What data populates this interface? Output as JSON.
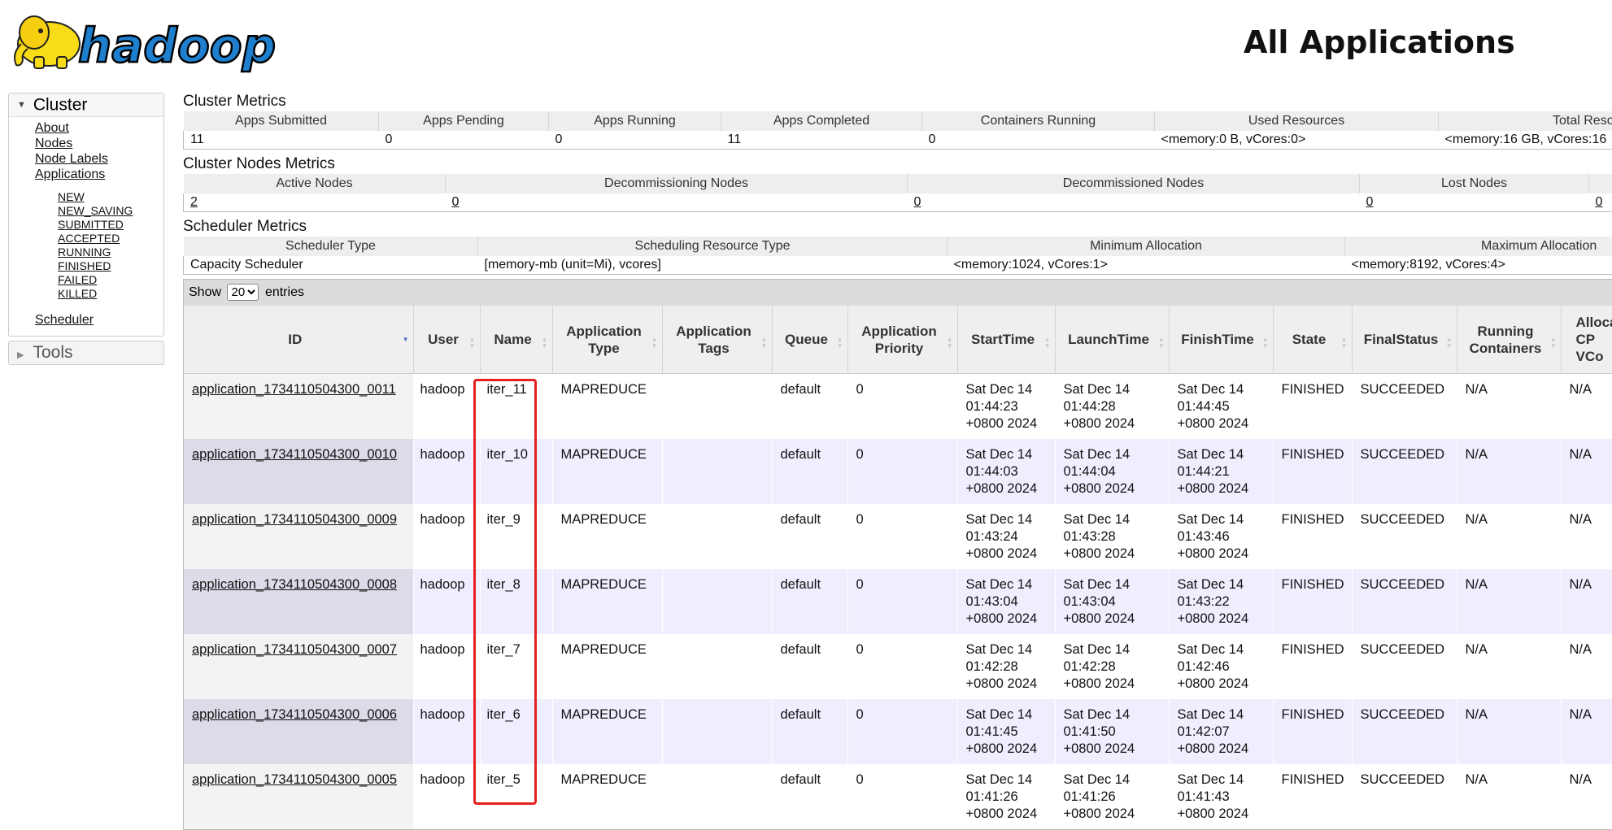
{
  "header": {
    "logo_text": "hadoop",
    "title": "All Applications"
  },
  "sidebar": {
    "cluster_label": "Cluster",
    "items": [
      "About",
      "Nodes",
      "Node Labels",
      "Applications"
    ],
    "app_states": [
      "NEW",
      "NEW_SAVING",
      "SUBMITTED",
      "ACCEPTED",
      "RUNNING",
      "FINISHED",
      "FAILED",
      "KILLED"
    ],
    "scheduler": "Scheduler",
    "tools_label": "Tools"
  },
  "cluster_metrics": {
    "title": "Cluster Metrics",
    "headers": [
      "Apps Submitted",
      "Apps Pending",
      "Apps Running",
      "Apps Completed",
      "Containers Running",
      "Used Resources",
      "Total Reso"
    ],
    "values": [
      "11",
      "0",
      "0",
      "11",
      "0",
      "<memory:0 B, vCores:0>",
      "<memory:16 GB, vCores:16"
    ]
  },
  "nodes_metrics": {
    "title": "Cluster Nodes Metrics",
    "headers": [
      "Active Nodes",
      "Decommissioning Nodes",
      "Decommissioned Nodes",
      "Lost Nodes",
      ""
    ],
    "values": [
      "2",
      "0",
      "0",
      "0",
      "0"
    ]
  },
  "scheduler_metrics": {
    "title": "Scheduler Metrics",
    "headers": [
      "Scheduler Type",
      "Scheduling Resource Type",
      "Minimum Allocation",
      "Maximum Allocation"
    ],
    "values": [
      "Capacity Scheduler",
      "[memory-mb (unit=Mi), vcores]",
      "<memory:1024, vCores:1>",
      "<memory:8192, vCores:4>"
    ]
  },
  "apps_table": {
    "show_label": "Show",
    "page_size": "20",
    "entries_label": "entries",
    "columns": [
      [
        "ID"
      ],
      [
        "User"
      ],
      [
        "Name"
      ],
      [
        "Application",
        "Type"
      ],
      [
        "Application",
        "Tags"
      ],
      [
        "Queue"
      ],
      [
        "Application",
        "Priority"
      ],
      [
        "StartTime"
      ],
      [
        "LaunchTime"
      ],
      [
        "FinishTime"
      ],
      [
        "State"
      ],
      [
        "FinalStatus"
      ],
      [
        "Running",
        "Containers"
      ],
      [
        "Alloca",
        "CP",
        "VCo"
      ]
    ],
    "rows": [
      {
        "id": "application_1734110504300_0011",
        "user": "hadoop",
        "name": "iter_11",
        "type": "MAPREDUCE",
        "tags": "",
        "queue": "default",
        "priority": "0",
        "start": [
          "Sat Dec 14",
          "01:44:23",
          "+0800 2024"
        ],
        "launch": [
          "Sat Dec 14",
          "01:44:28",
          "+0800 2024"
        ],
        "finish": [
          "Sat Dec 14",
          "01:44:45",
          "+0800 2024"
        ],
        "state": "FINISHED",
        "final": "SUCCEEDED",
        "running": "N/A",
        "alloc": "N/A"
      },
      {
        "id": "application_1734110504300_0010",
        "user": "hadoop",
        "name": "iter_10",
        "type": "MAPREDUCE",
        "tags": "",
        "queue": "default",
        "priority": "0",
        "start": [
          "Sat Dec 14",
          "01:44:03",
          "+0800 2024"
        ],
        "launch": [
          "Sat Dec 14",
          "01:44:04",
          "+0800 2024"
        ],
        "finish": [
          "Sat Dec 14",
          "01:44:21",
          "+0800 2024"
        ],
        "state": "FINISHED",
        "final": "SUCCEEDED",
        "running": "N/A",
        "alloc": "N/A"
      },
      {
        "id": "application_1734110504300_0009",
        "user": "hadoop",
        "name": "iter_9",
        "type": "MAPREDUCE",
        "tags": "",
        "queue": "default",
        "priority": "0",
        "start": [
          "Sat Dec 14",
          "01:43:24",
          "+0800 2024"
        ],
        "launch": [
          "Sat Dec 14",
          "01:43:28",
          "+0800 2024"
        ],
        "finish": [
          "Sat Dec 14",
          "01:43:46",
          "+0800 2024"
        ],
        "state": "FINISHED",
        "final": "SUCCEEDED",
        "running": "N/A",
        "alloc": "N/A"
      },
      {
        "id": "application_1734110504300_0008",
        "user": "hadoop",
        "name": "iter_8",
        "type": "MAPREDUCE",
        "tags": "",
        "queue": "default",
        "priority": "0",
        "start": [
          "Sat Dec 14",
          "01:43:04",
          "+0800 2024"
        ],
        "launch": [
          "Sat Dec 14",
          "01:43:04",
          "+0800 2024"
        ],
        "finish": [
          "Sat Dec 14",
          "01:43:22",
          "+0800 2024"
        ],
        "state": "FINISHED",
        "final": "SUCCEEDED",
        "running": "N/A",
        "alloc": "N/A"
      },
      {
        "id": "application_1734110504300_0007",
        "user": "hadoop",
        "name": "iter_7",
        "type": "MAPREDUCE",
        "tags": "",
        "queue": "default",
        "priority": "0",
        "start": [
          "Sat Dec 14",
          "01:42:28",
          "+0800 2024"
        ],
        "launch": [
          "Sat Dec 14",
          "01:42:28",
          "+0800 2024"
        ],
        "finish": [
          "Sat Dec 14",
          "01:42:46",
          "+0800 2024"
        ],
        "state": "FINISHED",
        "final": "SUCCEEDED",
        "running": "N/A",
        "alloc": "N/A"
      },
      {
        "id": "application_1734110504300_0006",
        "user": "hadoop",
        "name": "iter_6",
        "type": "MAPREDUCE",
        "tags": "",
        "queue": "default",
        "priority": "0",
        "start": [
          "Sat Dec 14",
          "01:41:45",
          "+0800 2024"
        ],
        "launch": [
          "Sat Dec 14",
          "01:41:50",
          "+0800 2024"
        ],
        "finish": [
          "Sat Dec 14",
          "01:42:07",
          "+0800 2024"
        ],
        "state": "FINISHED",
        "final": "SUCCEEDED",
        "running": "N/A",
        "alloc": "N/A"
      },
      {
        "id": "application_1734110504300_0005",
        "user": "hadoop",
        "name": "iter_5",
        "type": "MAPREDUCE",
        "tags": "",
        "queue": "default",
        "priority": "0",
        "start": [
          "Sat Dec 14",
          "01:41:26",
          "+0800 2024"
        ],
        "launch": [
          "Sat Dec 14",
          "01:41:26",
          "+0800 2024"
        ],
        "finish": [
          "Sat Dec 14",
          "01:41:43",
          "+0800 2024"
        ],
        "state": "FINISHED",
        "final": "SUCCEEDED",
        "running": "N/A",
        "alloc": "N/A"
      }
    ]
  },
  "colors": {
    "highlight": "#e52020",
    "even_row": "#eeeeff",
    "sort_active": "#4a6dc8",
    "logo_fill": "#1e7fcf",
    "elephant": "#f9dc18"
  }
}
